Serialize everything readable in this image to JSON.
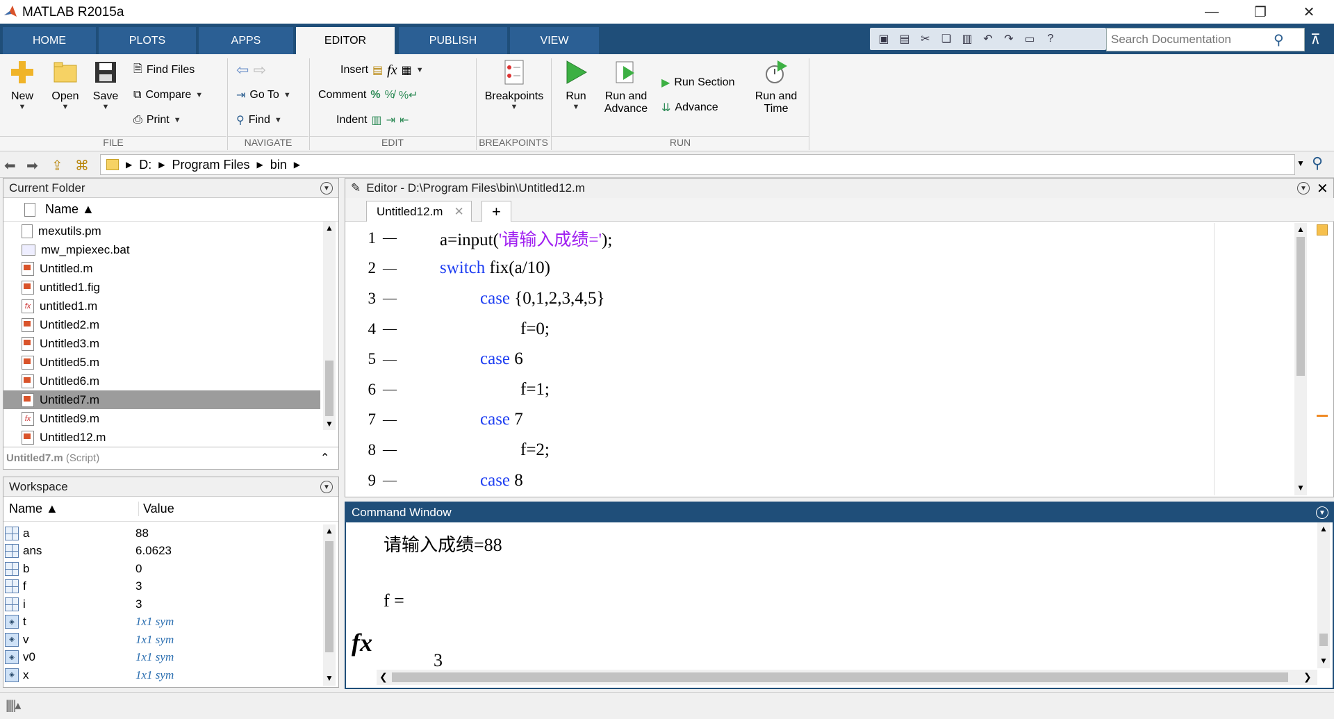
{
  "window": {
    "title": "MATLAB R2015a",
    "min": "—",
    "restore": "❐",
    "close": "✕"
  },
  "ribbon_tabs": [
    {
      "label": "HOME"
    },
    {
      "label": "PLOTS"
    },
    {
      "label": "APPS"
    },
    {
      "label": "EDITOR"
    },
    {
      "label": "PUBLISH"
    },
    {
      "label": "VIEW"
    }
  ],
  "search": {
    "placeholder": "Search Documentation"
  },
  "ribbon": {
    "file": {
      "label": "FILE",
      "new": "New",
      "open": "Open",
      "save": "Save",
      "find_files": "Find Files",
      "compare": "Compare",
      "print": "Print"
    },
    "navigate": {
      "label": "NAVIGATE",
      "go_to": "Go To",
      "find": "Find"
    },
    "edit": {
      "label": "EDIT",
      "insert": "Insert",
      "comment": "Comment",
      "indent": "Indent"
    },
    "breakpoints": {
      "label": "BREAKPOINTS",
      "breakpoints": "Breakpoints"
    },
    "run": {
      "label": "RUN",
      "run": "Run",
      "run_and_advance_1": "Run and",
      "run_and_advance_2": "Advance",
      "run_section": "Run Section",
      "advance": "Advance",
      "run_and_time_1": "Run and",
      "run_and_time_2": "Time"
    }
  },
  "path": {
    "segments": [
      "D:",
      "Program Files",
      "bin"
    ]
  },
  "current_folder": {
    "title": "Current Folder",
    "header": "Name ▲",
    "files": [
      {
        "name": "mexutils.pm",
        "icon": "doc"
      },
      {
        "name": "mw_mpiexec.bat",
        "icon": "bat"
      },
      {
        "name": "Untitled.m",
        "icon": "m"
      },
      {
        "name": "untitled1.fig",
        "icon": "m"
      },
      {
        "name": "untitled1.m",
        "icon": "fx"
      },
      {
        "name": "Untitled2.m",
        "icon": "m"
      },
      {
        "name": "Untitled3.m",
        "icon": "m"
      },
      {
        "name": "Untitled5.m",
        "icon": "m"
      },
      {
        "name": "Untitled6.m",
        "icon": "m"
      },
      {
        "name": "Untitled7.m",
        "icon": "m",
        "selected": true
      },
      {
        "name": "Untitled9.m",
        "icon": "fx"
      },
      {
        "name": "Untitled12.m",
        "icon": "m"
      }
    ],
    "details_name": "Untitled7.m",
    "details_type": "(Script)"
  },
  "workspace": {
    "title": "Workspace",
    "col_name": "Name ▲",
    "col_value": "Value",
    "vars": [
      {
        "name": "a",
        "value": "88",
        "sym": false
      },
      {
        "name": "ans",
        "value": "6.0623",
        "sym": false
      },
      {
        "name": "b",
        "value": "0",
        "sym": false
      },
      {
        "name": "f",
        "value": "3",
        "sym": false
      },
      {
        "name": "i",
        "value": "3",
        "sym": false
      },
      {
        "name": "t",
        "value": "1x1 sym",
        "sym": true
      },
      {
        "name": "v",
        "value": "1x1 sym",
        "sym": true
      },
      {
        "name": "v0",
        "value": "1x1 sym",
        "sym": true
      },
      {
        "name": "x",
        "value": "1x1 sym",
        "sym": true
      }
    ]
  },
  "editor": {
    "title": "Editor - D:\\Program Files\\bin\\Untitled12.m",
    "tab": "Untitled12.m",
    "add_tab": "+",
    "lines": [
      {
        "n": "1",
        "indent": 0,
        "parts": [
          {
            "t": "a=input(",
            "c": ""
          },
          {
            "t": "'请输入成绩='",
            "c": "str"
          },
          {
            "t": ");",
            "c": ""
          }
        ]
      },
      {
        "n": "2",
        "indent": 0,
        "parts": [
          {
            "t": "switch",
            "c": "kw"
          },
          {
            "t": " fix(a/10)",
            "c": ""
          }
        ]
      },
      {
        "n": "3",
        "indent": 1,
        "parts": [
          {
            "t": "case",
            "c": "kw"
          },
          {
            "t": " {0,1,2,3,4,5}",
            "c": ""
          }
        ]
      },
      {
        "n": "4",
        "indent": 2,
        "parts": [
          {
            "t": "f=0;",
            "c": ""
          }
        ]
      },
      {
        "n": "5",
        "indent": 1,
        "parts": [
          {
            "t": "case",
            "c": "kw"
          },
          {
            "t": " 6",
            "c": ""
          }
        ]
      },
      {
        "n": "6",
        "indent": 2,
        "parts": [
          {
            "t": "f=1;",
            "c": ""
          }
        ]
      },
      {
        "n": "7",
        "indent": 1,
        "parts": [
          {
            "t": "case",
            "c": "kw"
          },
          {
            "t": " 7",
            "c": ""
          }
        ]
      },
      {
        "n": "8",
        "indent": 2,
        "parts": [
          {
            "t": "f=2;",
            "c": ""
          }
        ]
      },
      {
        "n": "9",
        "indent": 1,
        "parts": [
          {
            "t": "case",
            "c": "kw"
          },
          {
            "t": " 8",
            "c": ""
          }
        ]
      }
    ]
  },
  "command_window": {
    "title": "Command Window",
    "prompt_line": "请输入成绩=88",
    "var_line": "f =",
    "value_line": "3",
    "fx": "fx"
  },
  "colors": {
    "ribbon_blue": "#1f4e79",
    "keyword": "#1f3ff2",
    "string": "#a020f0"
  }
}
